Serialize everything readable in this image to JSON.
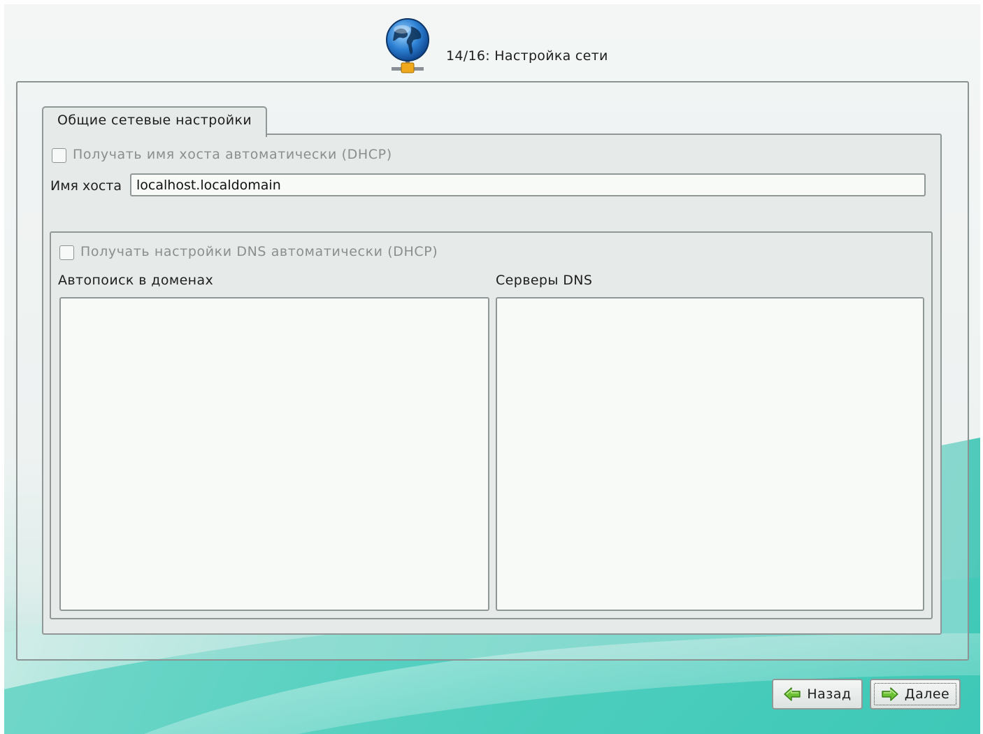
{
  "header": {
    "title": "14/16: Настройка сети",
    "icon": "network-globe-icon"
  },
  "tab": {
    "label": "Общие сетевые настройки"
  },
  "hostname": {
    "dhcp_checkbox_label": "Получать имя хоста автоматически (DHCP)",
    "dhcp_checked": false,
    "label": "Имя хоста",
    "value": "localhost.localdomain"
  },
  "dns": {
    "dhcp_checkbox_label": "Получать настройки DNS автоматически (DHCP)",
    "dhcp_checked": false,
    "search_domains_label": "Автопоиск в доменах",
    "search_domains": [],
    "servers_label": "Серверы DNS",
    "servers": []
  },
  "buttons": {
    "back_label": "Назад",
    "back_icon": "arrow-left-icon",
    "next_label": "Далее",
    "next_icon": "arrow-right-icon"
  },
  "colors": {
    "accent_teal": "#3fc8b8",
    "arrow_green": "#5cb82e",
    "panel_bg": "#e6eae9"
  }
}
